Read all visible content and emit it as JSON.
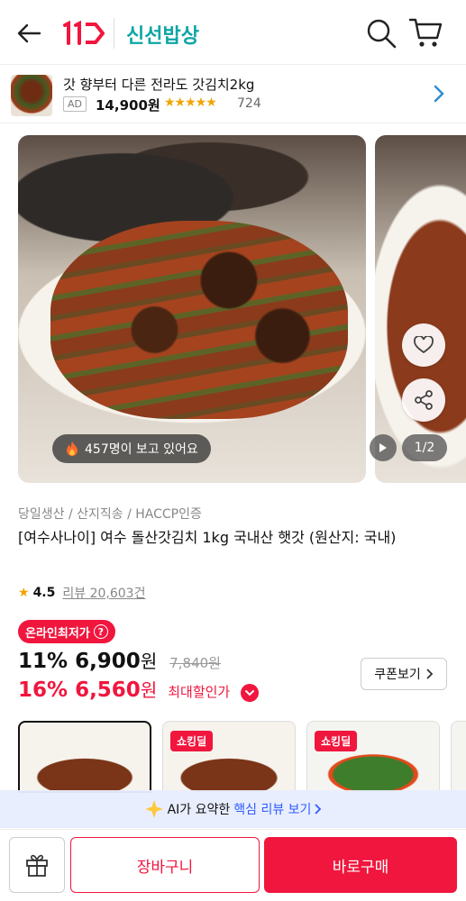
{
  "header": {
    "logo_text": "11",
    "store_name": "신선밥상",
    "colors": {
      "brand": "#f0163e",
      "store": "#0ea5a5"
    }
  },
  "mini_banner": {
    "title": "갓 향부터 다른 전라도 갓김치2kg",
    "ad_label": "AD",
    "price": "14,900원",
    "stars": "★★★★★",
    "review_count": "724",
    "rating_fraction": 0.9
  },
  "gallery": {
    "viewers_text": "457명이 보고 있어요",
    "pager": "1/2",
    "icons": [
      "fire-icon",
      "heart-icon",
      "share-icon",
      "play-icon"
    ]
  },
  "product": {
    "tags": "당일생산 / 산지직송 / HACCP인증",
    "title": "[여수사나이] 여수 돌산갓김치 1kg 국내산 햇갓 (원산지: 국내)",
    "rating": "4.5",
    "review_link": "리뷰 20,603건"
  },
  "pricing": {
    "lowest_badge": "온라인최저가",
    "discount1": "11%",
    "price1": "6,900",
    "won": "원",
    "original_price": "7,840원",
    "discount2": "16%",
    "price2": "6,560",
    "max_discount_label": "최대할인가",
    "coupon_button": "쿠폰보기"
  },
  "thumbnails": [
    {
      "deal": ""
    },
    {
      "deal": "쇼킹딜"
    },
    {
      "deal": "쇼킹딜"
    }
  ],
  "ai_bar": {
    "prefix": "AI가 요약한",
    "link": "핵심 리뷰 보기"
  },
  "bottom_bar": {
    "cart": "장바구니",
    "buy": "바로구매"
  }
}
